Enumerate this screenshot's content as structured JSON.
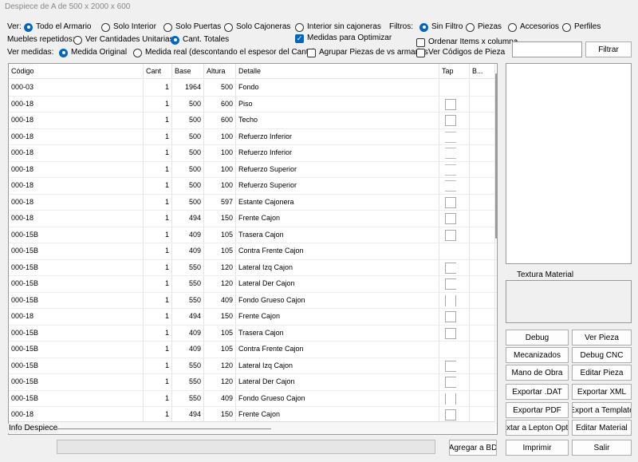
{
  "window": {
    "title": "Despiece de A de 500 x 2000 x 600"
  },
  "view": {
    "label": "Ver:",
    "options": [
      "Todo el Armario",
      "Solo Interior",
      "Solo Puertas",
      "Solo Cajoneras",
      "Interior sin cajoneras"
    ],
    "selected": "Todo el Armario"
  },
  "filters": {
    "label": "Filtros:",
    "options": [
      "Sin Filtro",
      "Piezas",
      "Accesorios",
      "Perfiles"
    ],
    "selected": "Sin Filtro"
  },
  "repeated": {
    "label": "Muebles repetidos:",
    "options": [
      "Ver Cantidades Unitarias",
      "Cant. Totales"
    ],
    "selected": "Cant. Totales"
  },
  "measures": {
    "label": "Ver medidas:",
    "options": [
      "Medida Original",
      "Medida real (descontando el espesor del Canto)"
    ],
    "selected": "Medida Original"
  },
  "checks": {
    "optimize": {
      "label": "Medidas para Optimizar",
      "checked": true
    },
    "group": {
      "label": "Agrupar Piezas de vs armarios",
      "checked": false
    },
    "sort": {
      "label": "Ordenar Items x columna",
      "checked": false
    },
    "codes": {
      "label": "Ver Códigos de Pieza",
      "checked": false
    }
  },
  "search": {
    "value": "",
    "button": "Filtrar"
  },
  "table": {
    "columns": [
      "Código",
      "Cant",
      "Base",
      "Altura",
      "Detalle",
      "Tap",
      "B..."
    ],
    "rows": [
      [
        "000-03",
        "1",
        "1964",
        "500",
        "Fondo"
      ],
      [
        "000-18",
        "1",
        "500",
        "600",
        "Piso"
      ],
      [
        "000-18",
        "1",
        "500",
        "600",
        "Techo"
      ],
      [
        "000-18",
        "1",
        "500",
        "100",
        "Refuerzo Inferior"
      ],
      [
        "000-18",
        "1",
        "500",
        "100",
        "Refuerzo Inferior"
      ],
      [
        "000-18",
        "1",
        "500",
        "100",
        "Refuerzo Superior"
      ],
      [
        "000-18",
        "1",
        "500",
        "100",
        "Refuerzo Superior"
      ],
      [
        "000-18",
        "1",
        "500",
        "597",
        "Estante Cajonera"
      ],
      [
        "000-18",
        "1",
        "494",
        "150",
        "Frente Cajon"
      ],
      [
        "000-15B",
        "1",
        "409",
        "105",
        "Trasera Cajon"
      ],
      [
        "000-15B",
        "1",
        "409",
        "105",
        "Contra Frente Cajon"
      ],
      [
        "000-15B",
        "1",
        "550",
        "120",
        "Lateral Izq Cajon"
      ],
      [
        "000-15B",
        "1",
        "550",
        "120",
        "Lateral Der Cajon"
      ],
      [
        "000-15B",
        "1",
        "550",
        "409",
        "Fondo Grueso Cajon"
      ],
      [
        "000-18",
        "1",
        "494",
        "150",
        "Frente Cajon"
      ],
      [
        "000-15B",
        "1",
        "409",
        "105",
        "Trasera Cajon"
      ],
      [
        "000-15B",
        "1",
        "409",
        "105",
        "Contra Frente Cajon"
      ],
      [
        "000-15B",
        "1",
        "550",
        "120",
        "Lateral Izq Cajon"
      ],
      [
        "000-15B",
        "1",
        "550",
        "120",
        "Lateral Der Cajon"
      ],
      [
        "000-15B",
        "1",
        "550",
        "409",
        "Fondo Grueso Cajon"
      ],
      [
        "000-18",
        "1",
        "494",
        "150",
        "Frente Cajon"
      ]
    ]
  },
  "info": {
    "label": "Info Despiece"
  },
  "texture": {
    "label": "Textura Material"
  },
  "buttons": {
    "debug": "Debug",
    "ver_pieza": "Ver Pieza",
    "mecanizados": "Mecanizados",
    "debug_cnc": "Debug CNC",
    "mano_obra": "Mano de Obra",
    "editar_pieza": "Editar Pieza",
    "exportar_dat": "Exportar .DAT",
    "exportar_xml": "Exportar XML",
    "exportar_pdf": "Exportar PDF",
    "exportar_template": "Export a Template",
    "exportar_lepton": "xtar a Lepton Opti",
    "editar_material": "Editar Material",
    "agregar_bd": "Agregar a BD",
    "imprimir": "Imprimir",
    "salir": "Salir"
  }
}
